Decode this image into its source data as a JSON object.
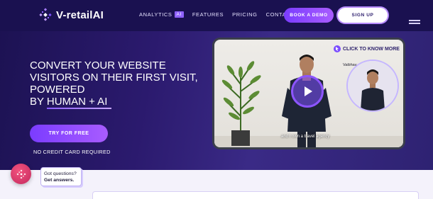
{
  "nav": {
    "logo_text": "V-retailAI",
    "links": [
      {
        "label": "ANALYTICS",
        "badge": "AI"
      },
      {
        "label": "FEATURES"
      },
      {
        "label": "PRICING"
      },
      {
        "label": "CONTACT"
      }
    ],
    "book_demo": "BOOK A DEMO",
    "sign_up": "SIGN UP"
  },
  "hero": {
    "headline_lines": [
      "CONVERT YOUR WEBSITE",
      "VISITORS ON THEIR FIRST VISIT,",
      "POWERED"
    ],
    "headline_prefix": "BY",
    "headline_highlight": "HUMAN + AI",
    "cta": "TRY FOR FREE",
    "note": "NO CREDIT CARD REQUIRED"
  },
  "video": {
    "cta": "CLICK TO KNOW MORE",
    "name_tag": "Vaibhav",
    "subtitle": "and I own a travel agency"
  },
  "chat": {
    "line1": "Got questions?",
    "line2": "Get answers."
  },
  "colors": {
    "hero_bg": "#2b1a6e",
    "accent": "#8f5cff",
    "chat_button": "#e23e6d"
  }
}
